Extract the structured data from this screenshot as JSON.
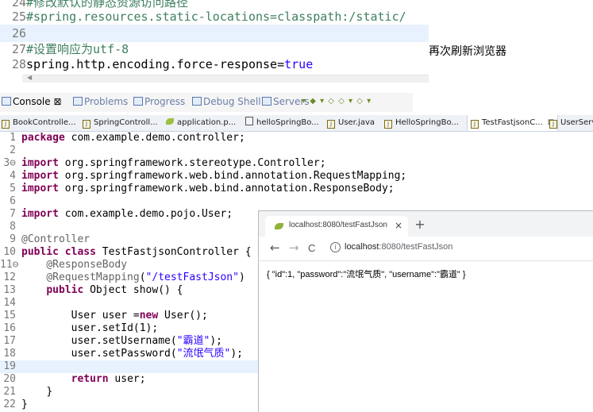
{
  "properties_editor": {
    "lines": [
      {
        "num": "24",
        "text": "#修改默认的静态资源访问路径",
        "kind": "comment"
      },
      {
        "num": "25",
        "text": "#spring.resources.static-locations=classpath:/static/",
        "kind": "comment"
      },
      {
        "num": "26",
        "text": "",
        "kind": "blank"
      },
      {
        "num": "27",
        "text": "#设置响应为utf-8",
        "kind": "comment"
      },
      {
        "num": "28",
        "key": "spring.http.encoding.force-response=",
        "value": "true",
        "kind": "property"
      }
    ]
  },
  "side_note": "再次刷新浏览器",
  "console_tabs": [
    {
      "label": "Console",
      "close": "⊠"
    },
    {
      "label": "Problems"
    },
    {
      "label": "Progress"
    },
    {
      "label": "Debug Shell"
    },
    {
      "label": "Servers"
    }
  ],
  "editor_tabs": [
    {
      "label": "BookControlle..."
    },
    {
      "label": "SpringControll..."
    },
    {
      "label": "application.p..."
    },
    {
      "label": "helloSpringBo..."
    },
    {
      "label": "User.java"
    },
    {
      "label": "HelloSpringBo..."
    },
    {
      "label": "TestFastjsonC...",
      "close": "⊠"
    },
    {
      "label": "UserServi"
    }
  ],
  "code": {
    "l1": {
      "num": "1",
      "kw": "package",
      "rest": " com.example.demo.controller;"
    },
    "l2": {
      "num": "2"
    },
    "l3": {
      "num": "3⊖",
      "kw": "import",
      "rest": " org.springframework.stereotype.Controller;"
    },
    "l4": {
      "num": "4",
      "kw": "import",
      "rest": " org.springframework.web.bind.annotation.RequestMapping;"
    },
    "l5": {
      "num": "5",
      "kw": "import",
      "rest": " org.springframework.web.bind.annotation.ResponseBody;"
    },
    "l6": {
      "num": "6"
    },
    "l7": {
      "num": "7",
      "kw": "import",
      "rest": " com.example.demo.pojo.User;"
    },
    "l8": {
      "num": "8"
    },
    "l9": {
      "num": "9",
      "ann": "@Controller"
    },
    "l10": {
      "num": "10",
      "kw1": "public",
      "kw2": "class",
      "rest": " TestFastjsonController {"
    },
    "l11": {
      "num": "11⊖",
      "ann": "@ResponseBody"
    },
    "l12": {
      "num": "12",
      "ann": "@RequestMapping",
      "open": "(",
      "str": "\"/testFastJson\"",
      "close": ")"
    },
    "l13": {
      "num": "13",
      "kw": "public",
      "rest": " Object show() {"
    },
    "l14": {
      "num": "14"
    },
    "l15": {
      "num": "15",
      "pre": "User ",
      "var": "user",
      "eq": " =",
      "kw": "new",
      "rest": " User();"
    },
    "l16": {
      "num": "16",
      "var": "user",
      "rest": ".setId(1);"
    },
    "l17": {
      "num": "17",
      "var": "user",
      "rest": ".setUsername(",
      "str": "\"霸道\"",
      "end": ");"
    },
    "l18": {
      "num": "18",
      "var": "user",
      "rest": ".setPassword(",
      "str": "\"流氓气质\"",
      "end": ");"
    },
    "l19": {
      "num": "19"
    },
    "l20": {
      "num": "20",
      "kw": "return",
      "rest": " user;"
    },
    "l21": {
      "num": "21",
      "rest": "}"
    },
    "l22": {
      "num": "22",
      "rest": "}"
    }
  },
  "browser": {
    "tab_title": "localhost:8080/testFastJson",
    "tab_close": "×",
    "new_tab": "+",
    "back": "←",
    "forward": "→",
    "reload": "C",
    "info": "i",
    "url_host": "localhost",
    "url_path": ":8080/testFastJson",
    "content": "{ \"id\":1, \"password\":\"流氓气质\", \"username\":\"霸道\" }"
  },
  "colors": {
    "keyword": "#7f0055",
    "string": "#2a00ff",
    "comment": "#3f7f5f",
    "current_line": "#e8f2fe"
  }
}
